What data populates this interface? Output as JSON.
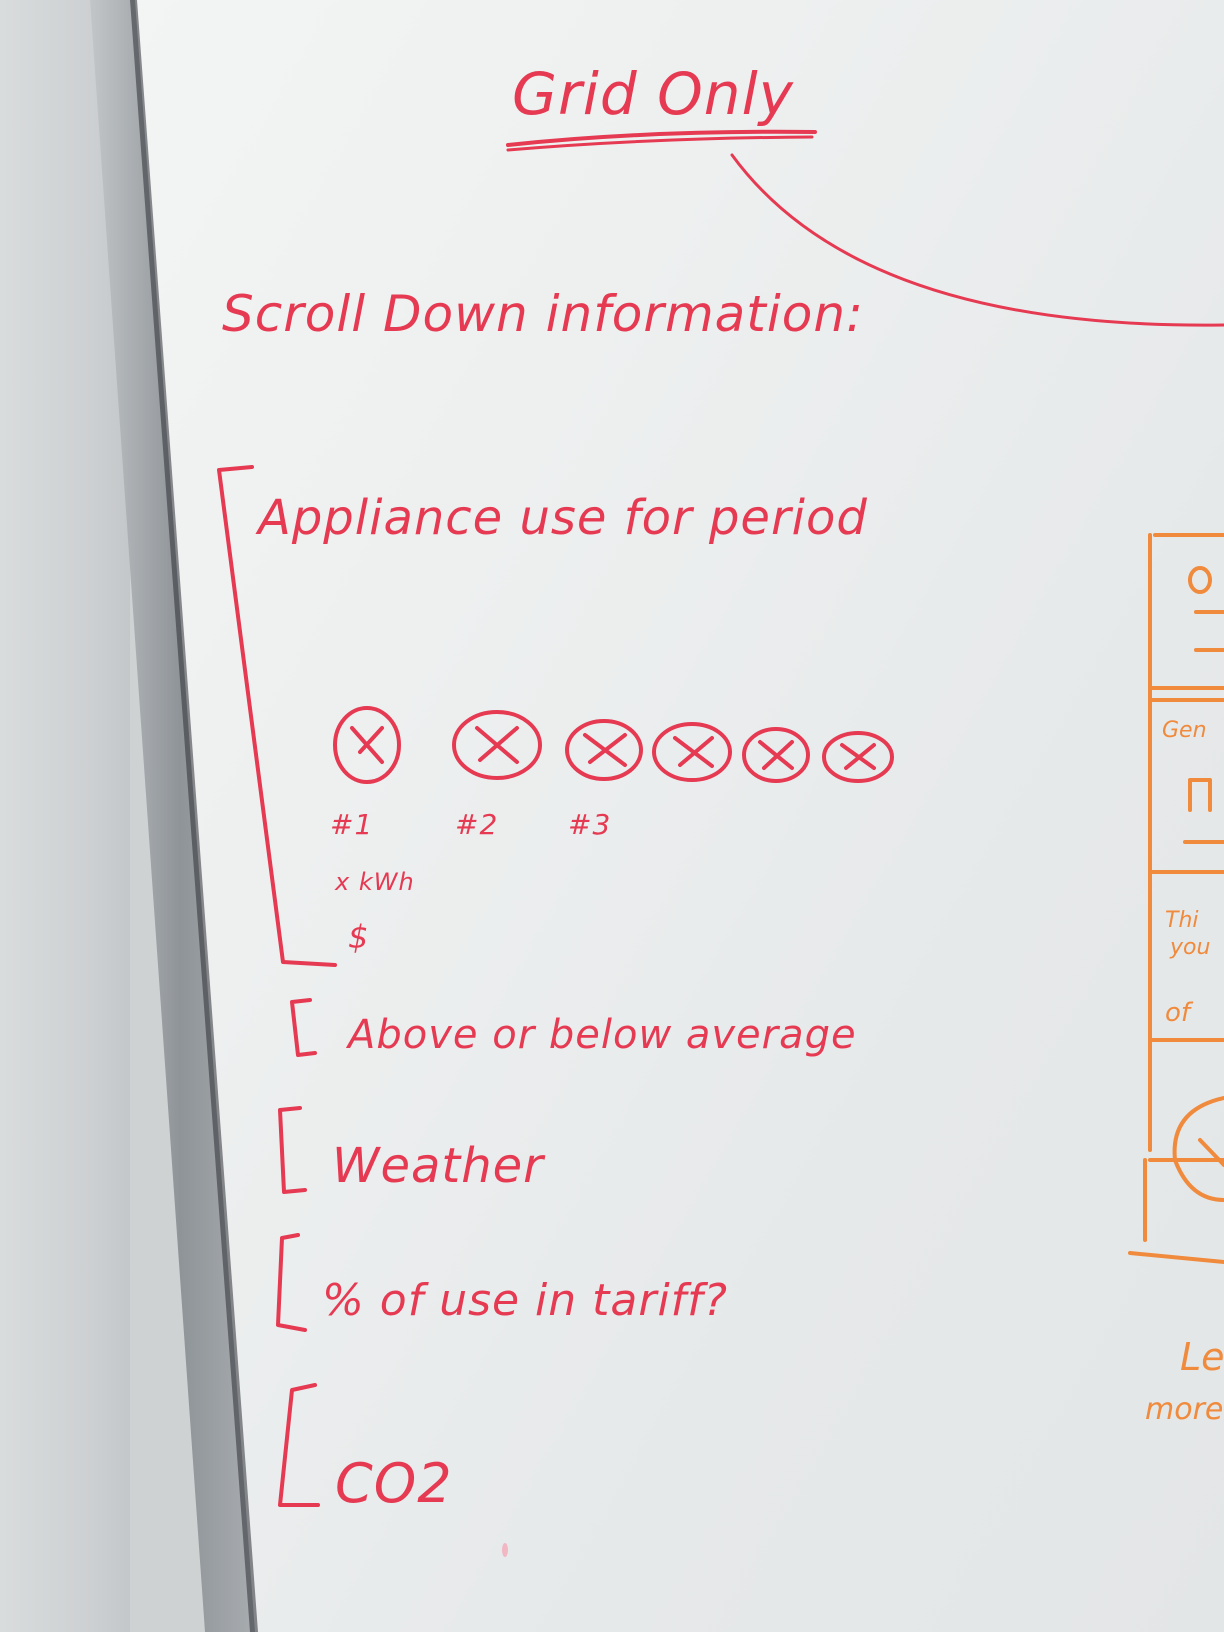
{
  "whiteboard": {
    "title": "Grid Only",
    "heading": "Scroll Down information:",
    "section_appliance": {
      "label": "Appliance use for period",
      "appliances": [
        {
          "id": "#1"
        },
        {
          "id": "#2"
        },
        {
          "id": "#3"
        }
      ],
      "notes": [
        "x kWh",
        "$"
      ]
    },
    "items": [
      "Above or below average",
      "Weather",
      "% of use in tariff?",
      "CO2"
    ],
    "orange_fragments": [
      "Gen",
      "Thi",
      "you",
      "of",
      "Le",
      "more"
    ]
  },
  "colors": {
    "red_marker": "#e53a52",
    "orange_marker": "#f08a3c",
    "board": "#eef0f0"
  }
}
